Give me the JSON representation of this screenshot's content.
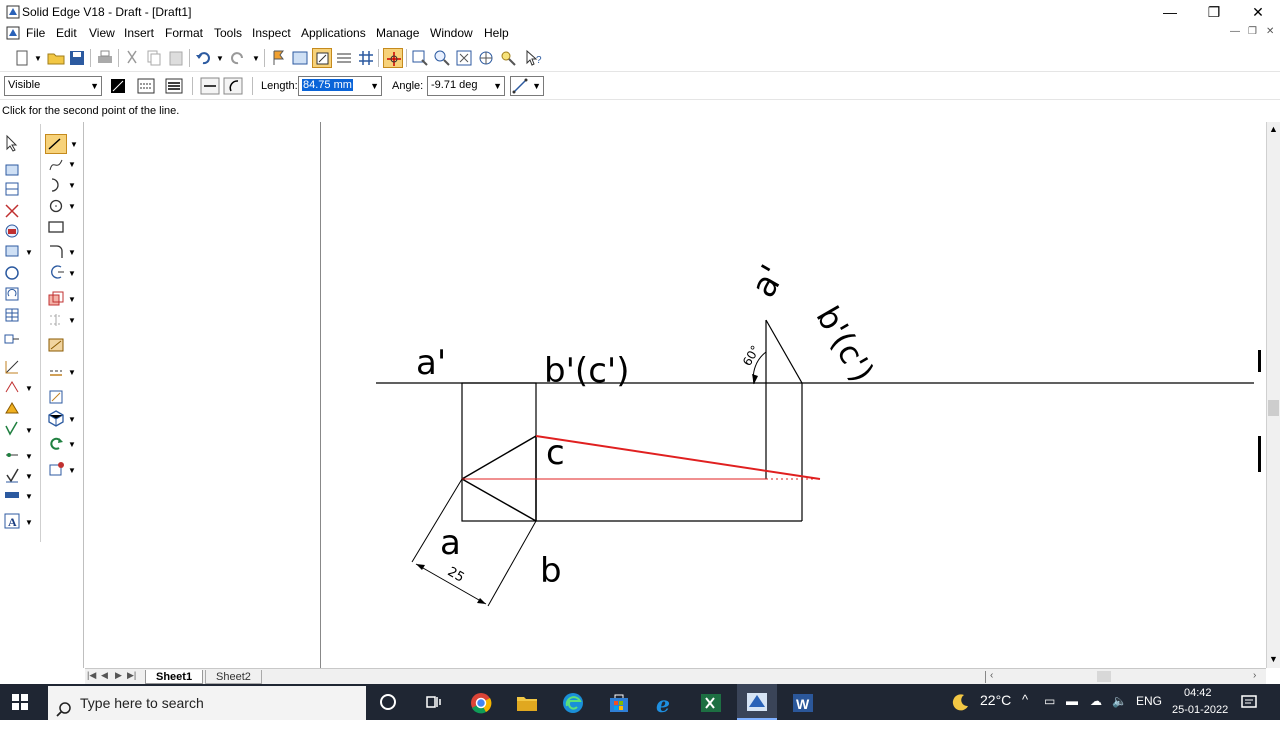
{
  "window": {
    "title": "Solid Edge V18 - Draft - [Draft1]"
  },
  "menus": [
    "File",
    "Edit",
    "View",
    "Insert",
    "Format",
    "Tools",
    "Inspect",
    "Applications",
    "Manage",
    "Window",
    "Help"
  ],
  "ribbon": {
    "line_style": "Visible",
    "length_label": "Length:",
    "length_value": "84.75 mm",
    "angle_label": "Angle:",
    "angle_value": "-9.71 deg"
  },
  "prompt": "Click for the second point of the line.",
  "drawing": {
    "labels": {
      "a_top": "a'",
      "bc_top": "b'(c')",
      "c": "c",
      "a": "a",
      "b": "b",
      "dim_25": "25",
      "dim_60": "60°",
      "a_rot": "a'",
      "bc_rot": "b'(c')"
    },
    "colors": {
      "sketch": "#000000",
      "active_line": "#e02020"
    }
  },
  "sheets": {
    "tab1": "Sheet1",
    "tab2": "Sheet2"
  },
  "taskbar": {
    "search_placeholder": "Type here to search",
    "weather": "22°C",
    "language": "ENG",
    "time": "04:42",
    "date": "25-01-2022"
  }
}
